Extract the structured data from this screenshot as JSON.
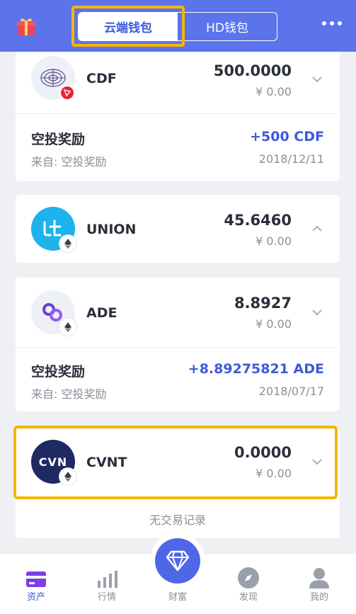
{
  "header": {
    "gift_icon": "gift-icon",
    "tabs": [
      {
        "label": "云端钱包",
        "active": true
      },
      {
        "label": "HD钱包",
        "active": false
      }
    ],
    "more_icon": "more-dots-icon"
  },
  "assets": [
    {
      "name": "CDF",
      "amount": "500.0000",
      "fiat": "¥ 0.00",
      "logo": "cdf-logo",
      "badge": "tron-badge-icon",
      "expanded": true,
      "transactions": [
        {
          "title": "空投奖励",
          "from": "来自: 空投奖励",
          "amount": "+500 CDF",
          "date": "2018/12/11"
        }
      ]
    },
    {
      "name": "UNION",
      "amount": "45.6460",
      "fiat": "¥ 0.00",
      "logo": "union-logo",
      "badge": "eth-badge-icon",
      "expanded": false,
      "transactions": []
    },
    {
      "name": "ADE",
      "amount": "8.8927",
      "fiat": "¥ 0.00",
      "logo": "ade-logo",
      "badge": "eth-badge-icon",
      "expanded": true,
      "transactions": [
        {
          "title": "空投奖励",
          "from": "来自: 空投奖励",
          "amount": "+8.89275821 ADE",
          "date": "2018/07/17"
        }
      ]
    },
    {
      "name": "CVNT",
      "logo_text": "CVN",
      "amount": "0.0000",
      "fiat": "¥ 0.00",
      "logo": "cvnt-logo",
      "badge": "eth-badge-icon",
      "expanded": true,
      "empty_text": "无交易记录",
      "transactions": []
    }
  ],
  "bottom_nav": {
    "items": [
      {
        "label": "资产",
        "icon": "wallet-card-icon",
        "active": true
      },
      {
        "label": "行情",
        "icon": "bar-chart-icon",
        "active": false
      },
      {
        "label": "财富",
        "icon": "diamond-icon",
        "active": false
      },
      {
        "label": "发现",
        "icon": "compass-icon",
        "active": false
      },
      {
        "label": "我的",
        "icon": "user-icon",
        "active": false
      }
    ]
  },
  "colors": {
    "primary": "#5b74ec",
    "accent_blue": "#3e5ad8",
    "highlight": "#f7b500",
    "background": "#eef0f4"
  }
}
